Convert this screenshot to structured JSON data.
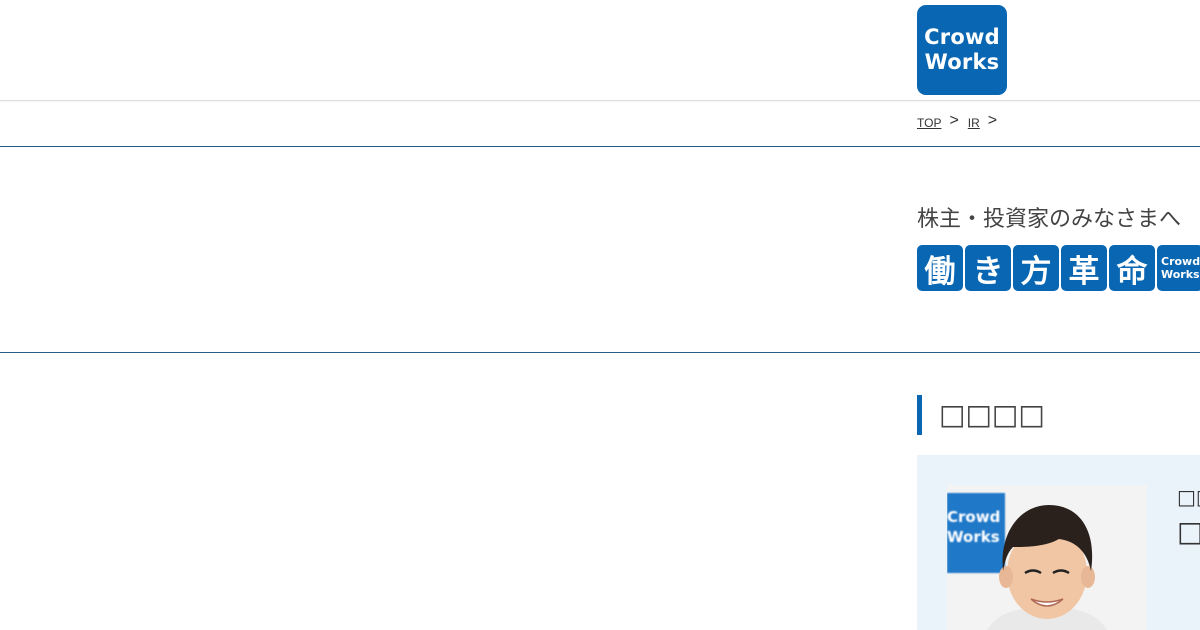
{
  "header": {
    "logo_line1": "Crowd",
    "logo_line2": "Works",
    "brand_color": "#0866b2"
  },
  "breadcrumb": {
    "items": [
      {
        "label": "TOP"
      },
      {
        "label": "IR"
      }
    ],
    "separator": ">"
  },
  "hero": {
    "heading": "株主・投資家のみなさまへ",
    "tiles": [
      "働",
      "き",
      "方",
      "革",
      "命"
    ],
    "tile_logo_line1": "Crowd",
    "tile_logo_line2": "Works"
  },
  "section": {
    "title": "□□□□"
  },
  "profile_card": {
    "photo_sign_line1": "Crowd",
    "photo_sign_line2": "Works",
    "subtitle": "□□",
    "name": "□□"
  }
}
